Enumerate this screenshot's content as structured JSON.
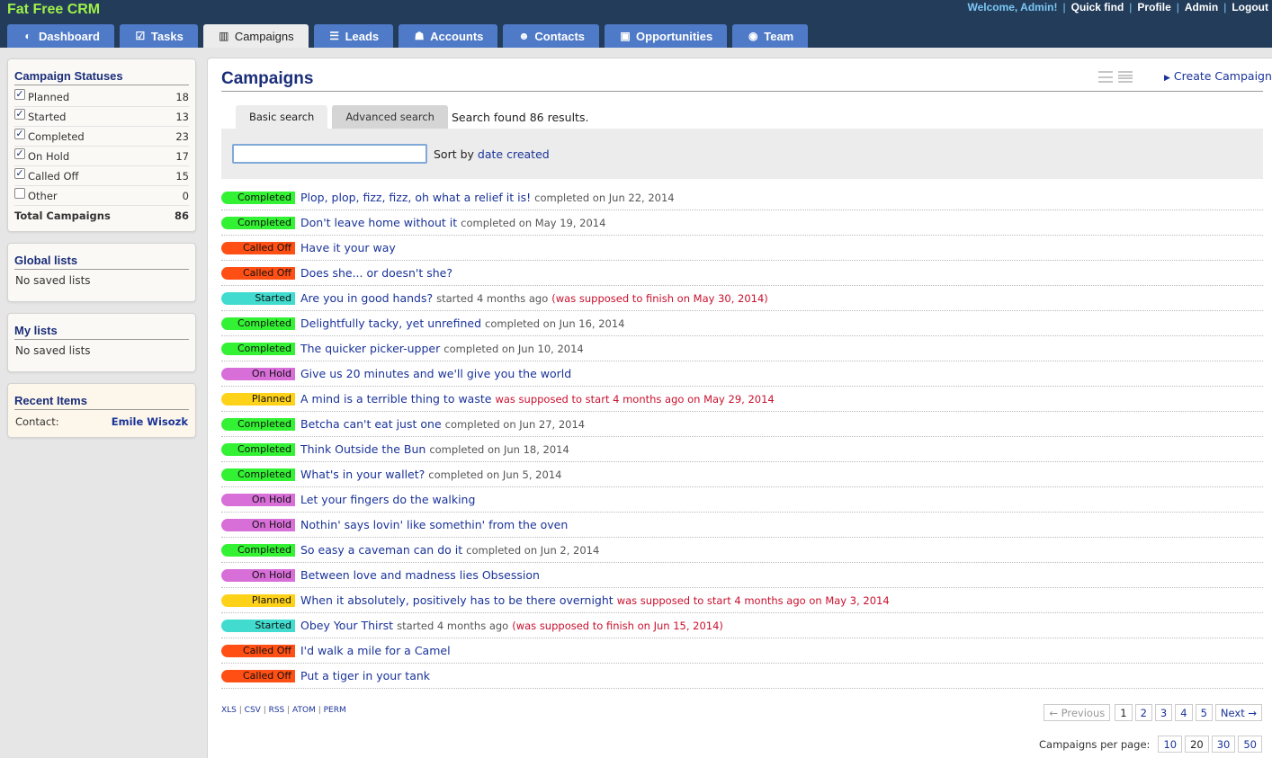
{
  "app": {
    "brand": "Fat Free CRM"
  },
  "topnav": {
    "welcome": "Welcome, Admin!",
    "quick_find": "Quick find",
    "profile": "Profile",
    "admin": "Admin",
    "logout": "Logout",
    "separator": "|"
  },
  "tabs": [
    {
      "label": "Dashboard",
      "icon": "dashboard-icon",
      "glyph": "◐"
    },
    {
      "label": "Tasks",
      "icon": "check-icon",
      "glyph": "☑"
    },
    {
      "label": "Campaigns",
      "icon": "bar-chart-icon",
      "glyph": "▥"
    },
    {
      "label": "Leads",
      "icon": "list-icon",
      "glyph": "☰"
    },
    {
      "label": "Accounts",
      "icon": "group-icon",
      "glyph": "☗"
    },
    {
      "label": "Contacts",
      "icon": "user-icon",
      "glyph": "☻"
    },
    {
      "label": "Opportunities",
      "icon": "money-icon",
      "glyph": "▣"
    },
    {
      "label": "Team",
      "icon": "globe-icon",
      "glyph": "◉"
    }
  ],
  "sidebar": {
    "statuses": {
      "title": "Campaign Statuses",
      "items": [
        {
          "label": "Planned",
          "count": "18",
          "checked": true
        },
        {
          "label": "Started",
          "count": "13",
          "checked": true
        },
        {
          "label": "Completed",
          "count": "23",
          "checked": true
        },
        {
          "label": "On Hold",
          "count": "17",
          "checked": true
        },
        {
          "label": "Called Off",
          "count": "15",
          "checked": true
        },
        {
          "label": "Other",
          "count": "0",
          "checked": false
        }
      ],
      "total_label": "Total Campaigns",
      "total_count": "86"
    },
    "global_lists": {
      "title": "Global lists",
      "empty": "No saved lists"
    },
    "my_lists": {
      "title": "My lists",
      "empty": "No saved lists"
    },
    "recent": {
      "title": "Recent Items",
      "label": "Contact:",
      "value": "Emile Wisozk"
    }
  },
  "main": {
    "title": "Campaigns",
    "create_link": "Create Campaign",
    "search": {
      "basic_tab": "Basic search",
      "advanced_tab": "Advanced search",
      "found": "Search found 86 results.",
      "input_value": "",
      "sort_prefix": "Sort by",
      "sort_value": "date created"
    },
    "status_colors": {
      "Completed": "#33f233",
      "Called Off": "#ff4f14",
      "Started": "#41dccf",
      "On Hold": "#d86ed8",
      "Planned": "#ffd21a"
    },
    "campaigns": [
      {
        "status": "Completed",
        "name": "Plop, plop, fizz, fizz, oh what a relief it is!",
        "note": "completed on Jun 22, 2014",
        "warn": ""
      },
      {
        "status": "Completed",
        "name": "Don't leave home without it",
        "note": "completed on May 19, 2014",
        "warn": ""
      },
      {
        "status": "Called Off",
        "name": "Have it your way",
        "note": "",
        "warn": ""
      },
      {
        "status": "Called Off",
        "name": "Does she... or doesn't she?",
        "note": "",
        "warn": ""
      },
      {
        "status": "Started",
        "name": "Are you in good hands?",
        "note": "started 4 months ago",
        "warn": "(was supposed to finish on May 30, 2014)"
      },
      {
        "status": "Completed",
        "name": "Delightfully tacky, yet unrefined",
        "note": "completed on Jun 16, 2014",
        "warn": ""
      },
      {
        "status": "Completed",
        "name": "The quicker picker-upper",
        "note": "completed on Jun 10, 2014",
        "warn": ""
      },
      {
        "status": "On Hold",
        "name": "Give us 20 minutes and we'll give you the world",
        "note": "",
        "warn": ""
      },
      {
        "status": "Planned",
        "name": "A mind is a terrible thing to waste",
        "note": "",
        "warn": "was supposed to start 4 months ago on May 29, 2014"
      },
      {
        "status": "Completed",
        "name": "Betcha can't eat just one",
        "note": "completed on Jun 27, 2014",
        "warn": ""
      },
      {
        "status": "Completed",
        "name": "Think Outside the Bun",
        "note": "completed on Jun 18, 2014",
        "warn": ""
      },
      {
        "status": "Completed",
        "name": "What's in your wallet?",
        "note": "completed on Jun 5, 2014",
        "warn": ""
      },
      {
        "status": "On Hold",
        "name": "Let your fingers do the walking",
        "note": "",
        "warn": ""
      },
      {
        "status": "On Hold",
        "name": "Nothin' says lovin' like somethin' from the oven",
        "note": "",
        "warn": ""
      },
      {
        "status": "Completed",
        "name": "So easy a caveman can do it",
        "note": "completed on Jun 2, 2014",
        "warn": ""
      },
      {
        "status": "On Hold",
        "name": "Between love and madness lies Obsession",
        "note": "",
        "warn": ""
      },
      {
        "status": "Planned",
        "name": "When it absolutely, positively has to be there overnight",
        "note": "",
        "warn": "was supposed to start 4 months ago on May 3, 2014"
      },
      {
        "status": "Started",
        "name": "Obey Your Thirst",
        "note": "started 4 months ago",
        "warn": "(was supposed to finish on Jun 15, 2014)"
      },
      {
        "status": "Called Off",
        "name": "I'd walk a mile for a Camel",
        "note": "",
        "warn": ""
      },
      {
        "status": "Called Off",
        "name": "Put a tiger in your tank",
        "note": "",
        "warn": ""
      }
    ],
    "exports": [
      "XLS",
      "CSV",
      "RSS",
      "ATOM",
      "PERM"
    ],
    "pager": {
      "previous": "← Previous",
      "pages": [
        "1",
        "2",
        "3",
        "4",
        "5"
      ],
      "next": "Next →"
    },
    "per_page": {
      "label": "Campaigns per page:",
      "options": [
        "10",
        "20",
        "30",
        "50"
      ],
      "selected": "20"
    }
  }
}
